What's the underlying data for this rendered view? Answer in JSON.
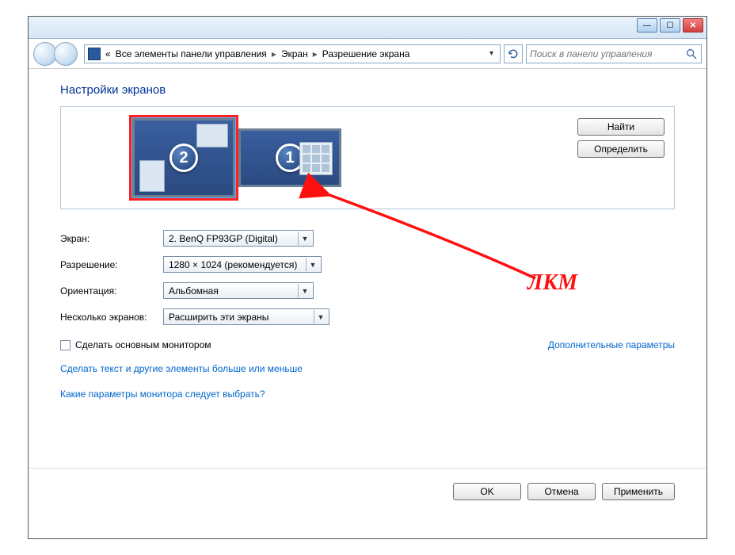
{
  "breadcrumb": {
    "prefix": "«",
    "level1": "Все элементы панели управления",
    "level2": "Экран",
    "level3": "Разрешение экрана"
  },
  "search": {
    "placeholder": "Поиск в панели управления"
  },
  "heading": "Настройки экранов",
  "monitors": {
    "m2_num": "2",
    "m1_num": "1"
  },
  "side_buttons": {
    "find": "Найти",
    "identify": "Определить"
  },
  "labels": {
    "screen": "Экран:",
    "resolution": "Разрешение:",
    "orientation": "Ориентация:",
    "multi": "Несколько экранов:"
  },
  "values": {
    "screen": "2. BenQ FP93GP (Digital)",
    "resolution": "1280 × 1024 (рекомендуется)",
    "orientation": "Альбомная",
    "multi": "Расширить эти экраны"
  },
  "check": {
    "make_primary": "Сделать основным монитором",
    "advanced": "Дополнительные параметры"
  },
  "links": {
    "text_size": "Сделать текст и другие элементы больше или меньше",
    "which": "Какие параметры монитора следует выбрать?"
  },
  "buttons": {
    "ok": "OK",
    "cancel": "Отмена",
    "apply": "Применить"
  },
  "annotation": {
    "label": "ЛКМ"
  }
}
